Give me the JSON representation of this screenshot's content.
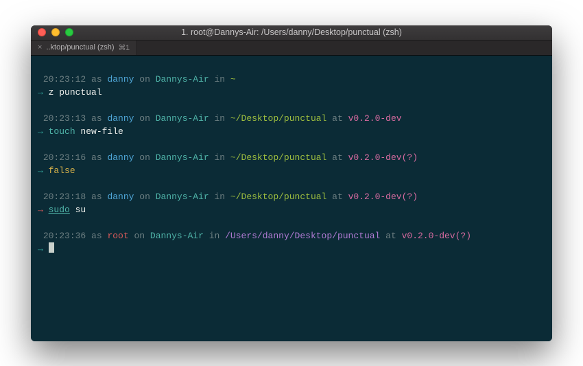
{
  "window": {
    "title": "1. root@Dannys-Air: /Users/danny/Desktop/punctual (zsh)"
  },
  "tab": {
    "close": "×",
    "label": "..ktop/punctual (zsh)",
    "shortcut": "⌘1"
  },
  "prompts": [
    {
      "time": "20:23:12",
      "user": "danny",
      "userClass": "blue",
      "host": "Dannys-Air",
      "path": "~",
      "pathClass": "green",
      "vcs": "",
      "vcsClass": "",
      "arrowClass": "arrow",
      "cmd": {
        "parts": [
          {
            "text": "z",
            "class": "white"
          },
          {
            "text": " punctual",
            "class": "white"
          }
        ]
      }
    },
    {
      "time": "20:23:13",
      "user": "danny",
      "userClass": "blue",
      "host": "Dannys-Air",
      "path": "~/Desktop/punctual",
      "pathClass": "green",
      "vcs": "v0.2.0-dev",
      "vcsClass": "pink",
      "arrowClass": "arrow",
      "cmd": {
        "parts": [
          {
            "text": "touch",
            "class": "teal"
          },
          {
            "text": " new-file",
            "class": "white"
          }
        ]
      }
    },
    {
      "time": "20:23:16",
      "user": "danny",
      "userClass": "blue",
      "host": "Dannys-Air",
      "path": "~/Desktop/punctual",
      "pathClass": "green",
      "vcs": "v0.2.0-dev(?)",
      "vcsClass": "pink",
      "arrowClass": "arrow",
      "cmd": {
        "parts": [
          {
            "text": "false",
            "class": "yellow"
          }
        ]
      }
    },
    {
      "time": "20:23:18",
      "user": "danny",
      "userClass": "blue",
      "host": "Dannys-Air",
      "path": "~/Desktop/punctual",
      "pathClass": "green",
      "vcs": "v0.2.0-dev(?)",
      "vcsClass": "pink",
      "arrowClass": "arrow-err",
      "cmd": {
        "parts": [
          {
            "text": "sudo",
            "class": "teal underline"
          },
          {
            "text": " su",
            "class": "white"
          }
        ]
      }
    },
    {
      "time": "20:23:36",
      "user": "root",
      "userClass": "red",
      "host": "Dannys-Air",
      "path": "/Users/danny/Desktop/punctual",
      "pathClass": "purple",
      "vcs": "v0.2.0-dev(?)",
      "vcsClass": "pink",
      "arrowClass": "arrow",
      "cmd": null
    }
  ],
  "words": {
    "as": "as",
    "on": "on",
    "in": "in",
    "at": "at",
    "arrow": "→"
  }
}
